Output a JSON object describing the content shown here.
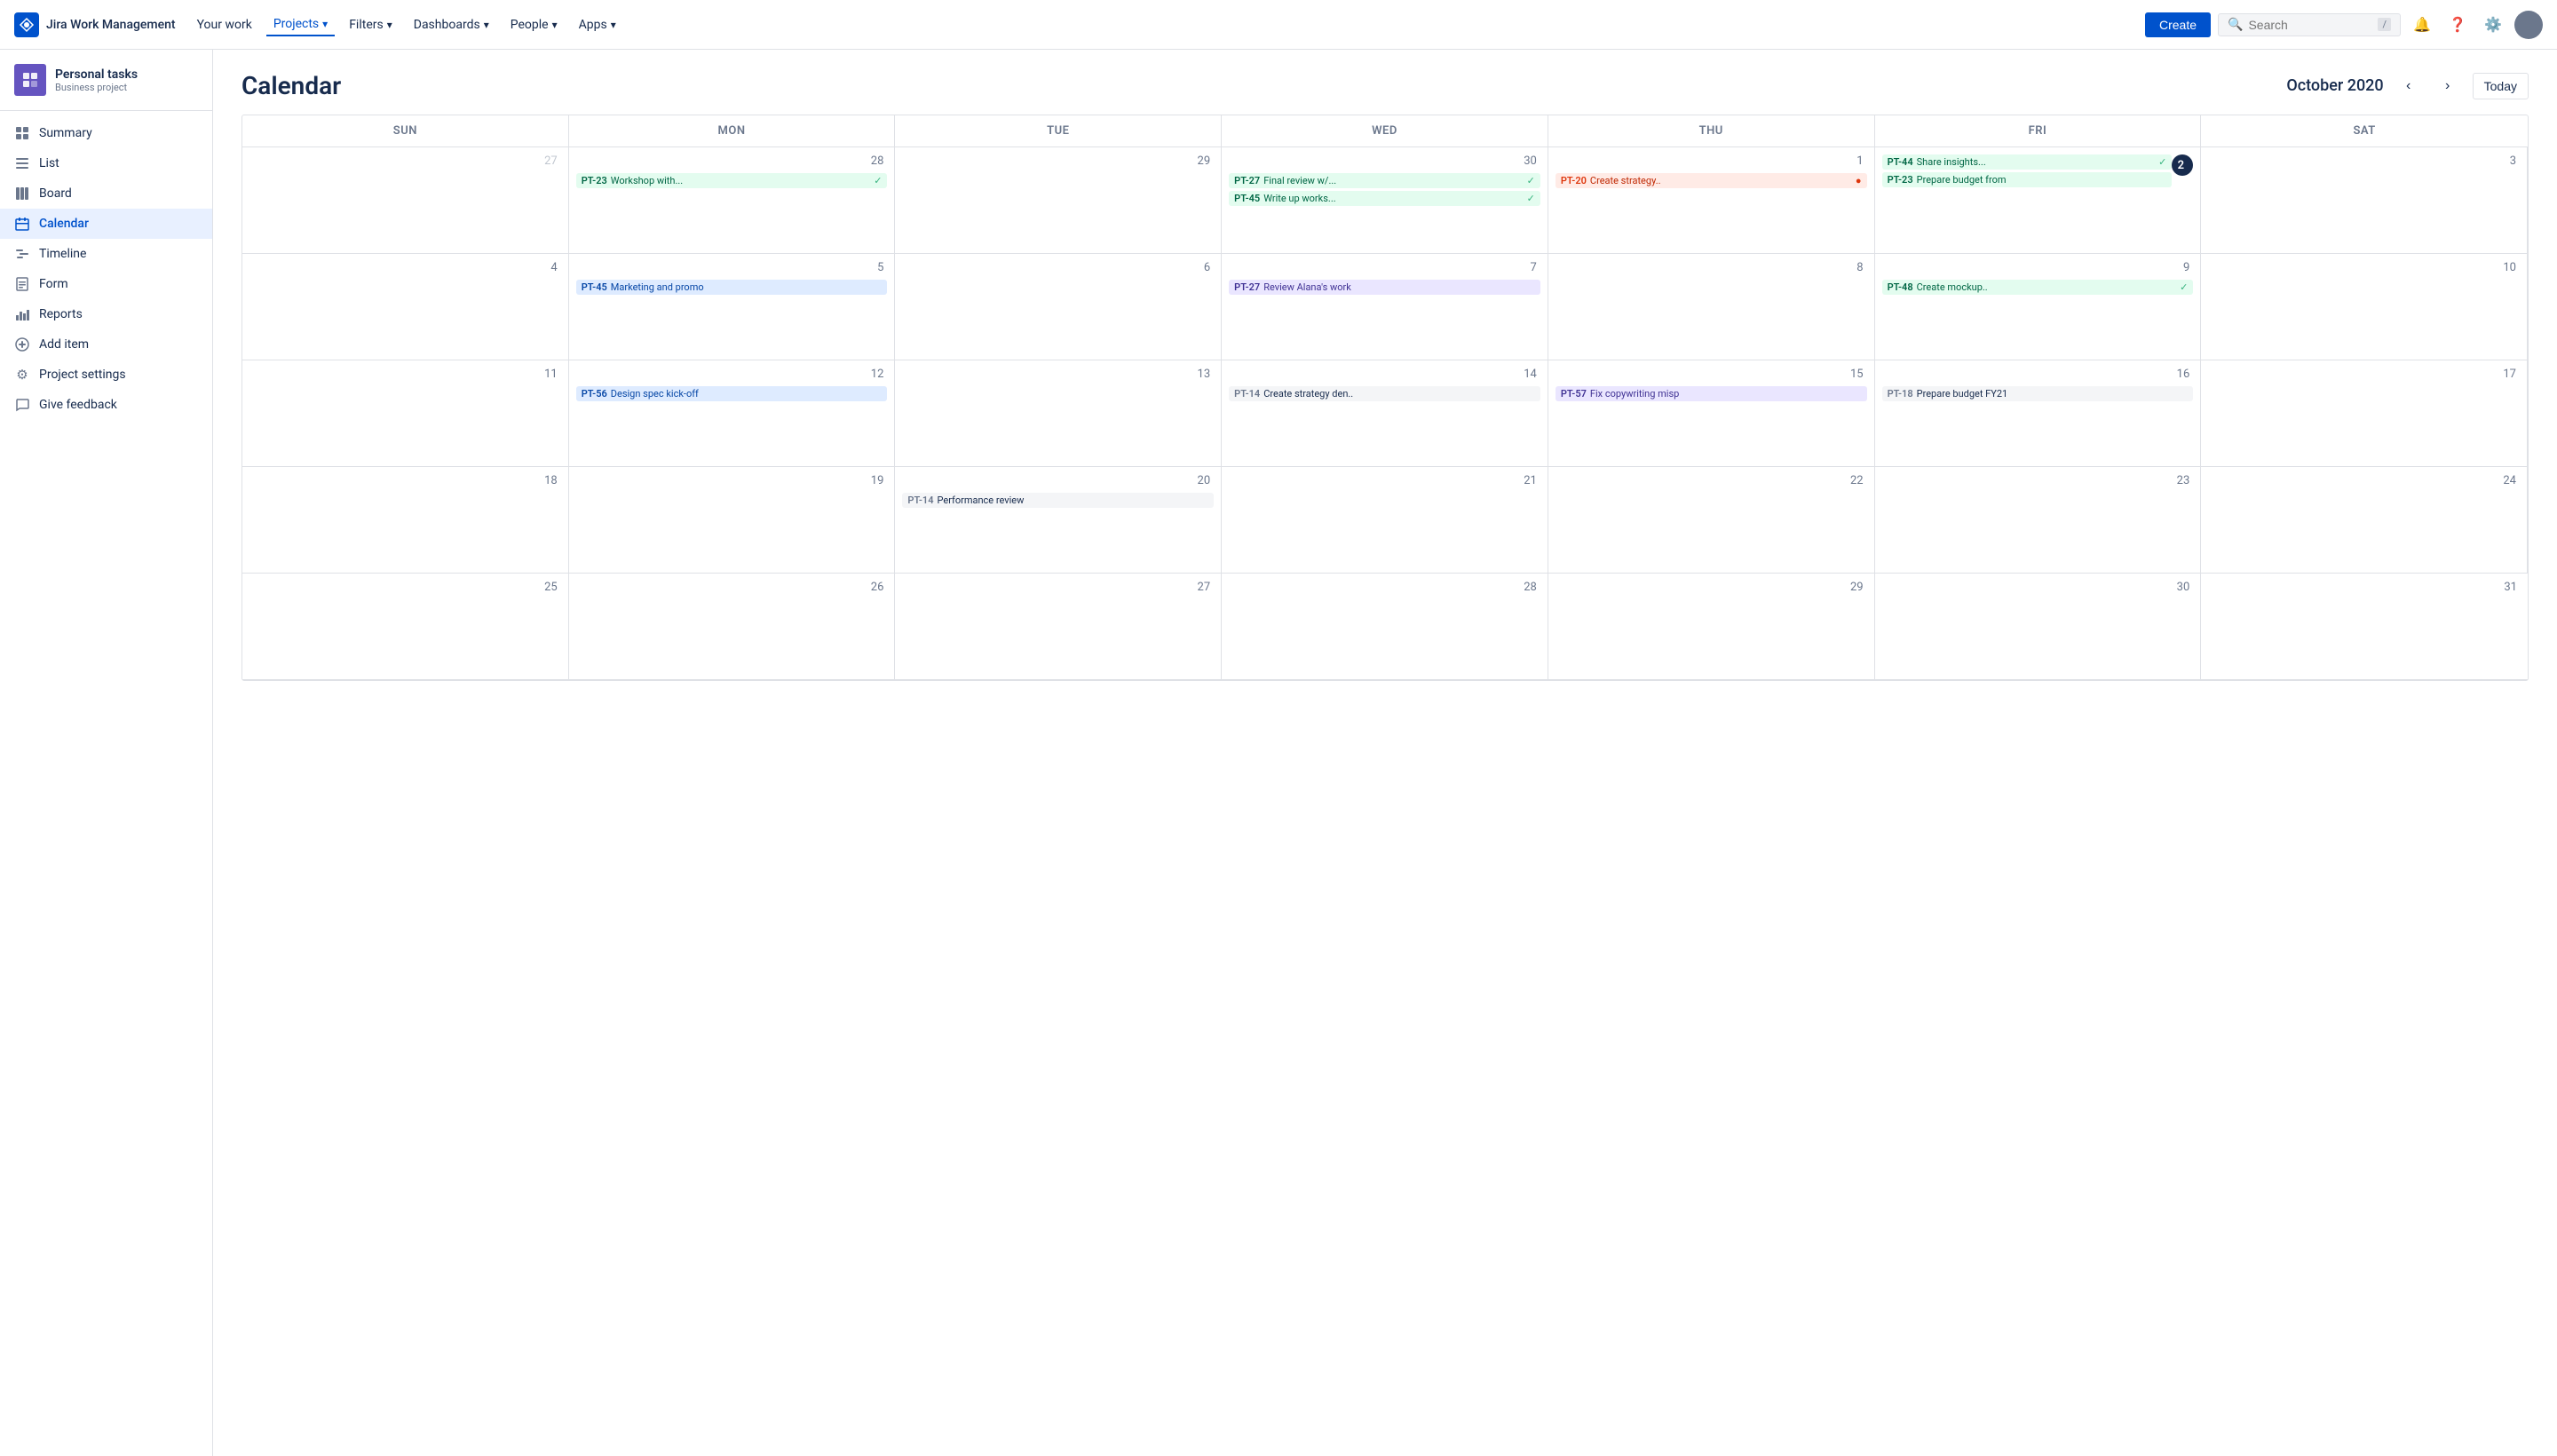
{
  "topnav": {
    "brand": "Jira Work Management",
    "items": [
      {
        "label": "Your work",
        "active": false
      },
      {
        "label": "Projects",
        "active": true
      },
      {
        "label": "Filters",
        "active": false
      },
      {
        "label": "Dashboards",
        "active": false
      },
      {
        "label": "People",
        "active": false
      },
      {
        "label": "Apps",
        "active": false
      }
    ],
    "create_label": "Create",
    "search_placeholder": "Search",
    "search_shortcut": "/"
  },
  "sidebar": {
    "project_name": "Personal tasks",
    "project_type": "Business project",
    "nav_items": [
      {
        "label": "Summary",
        "icon": "▦",
        "active": false
      },
      {
        "label": "List",
        "icon": "≡",
        "active": false
      },
      {
        "label": "Board",
        "icon": "⊞",
        "active": false
      },
      {
        "label": "Calendar",
        "icon": "▦",
        "active": true
      },
      {
        "label": "Timeline",
        "icon": "⊟",
        "active": false
      },
      {
        "label": "Form",
        "icon": "☐",
        "active": false
      },
      {
        "label": "Reports",
        "icon": "⌇",
        "active": false
      },
      {
        "label": "Add item",
        "icon": "⊕",
        "active": false
      },
      {
        "label": "Project settings",
        "icon": "⚙",
        "active": false
      },
      {
        "label": "Give feedback",
        "icon": "☍",
        "active": false
      }
    ]
  },
  "calendar": {
    "title": "Calendar",
    "month": "October 2020",
    "today_label": "Today",
    "day_headers": [
      "SUN",
      "MON",
      "TUE",
      "WED",
      "THU",
      "FRI",
      "SAT"
    ],
    "weeks": [
      {
        "days": [
          {
            "date": "27",
            "other_month": true,
            "tasks": []
          },
          {
            "date": "28",
            "other_month": false,
            "tasks": [
              {
                "id": "PT-23",
                "label": "Workshop with...",
                "color": "green",
                "check": true
              }
            ]
          },
          {
            "date": "29",
            "other_month": false,
            "tasks": []
          },
          {
            "date": "30",
            "other_month": false,
            "tasks": [
              {
                "id": "PT-27",
                "label": "Final review w/...",
                "color": "green",
                "check": true
              },
              {
                "id": "PT-45",
                "label": "Write up works...",
                "color": "green",
                "check": true
              }
            ]
          },
          {
            "date": "1",
            "other_month": false,
            "tasks": [
              {
                "id": "PT-20",
                "label": "Create strategy..",
                "color": "red",
                "error": true
              }
            ]
          },
          {
            "date": "2",
            "other_month": false,
            "today": true,
            "tasks": [
              {
                "id": "PT-44",
                "label": "Share insights...",
                "color": "green",
                "check": true
              },
              {
                "id": "PT-23",
                "label": "Prepare budget from",
                "color": "green",
                "check": false
              }
            ]
          },
          {
            "date": "3",
            "other_month": false,
            "tasks": []
          }
        ]
      },
      {
        "days": [
          {
            "date": "4",
            "other_month": false,
            "tasks": []
          },
          {
            "date": "5",
            "other_month": false,
            "tasks": [
              {
                "id": "PT-45",
                "label": "Marketing and promo",
                "color": "blue",
                "check": false
              }
            ]
          },
          {
            "date": "6",
            "other_month": false,
            "tasks": []
          },
          {
            "date": "7",
            "other_month": false,
            "tasks": [
              {
                "id": "PT-27",
                "label": "Review Alana's work",
                "color": "purple",
                "check": false
              }
            ]
          },
          {
            "date": "8",
            "other_month": false,
            "tasks": []
          },
          {
            "date": "9",
            "other_month": false,
            "tasks": [
              {
                "id": "PT-48",
                "label": "Create mockup..",
                "color": "green",
                "check": true
              }
            ]
          },
          {
            "date": "10",
            "other_month": false,
            "tasks": []
          }
        ]
      },
      {
        "days": [
          {
            "date": "11",
            "other_month": false,
            "tasks": []
          },
          {
            "date": "12",
            "other_month": false,
            "tasks": [
              {
                "id": "PT-56",
                "label": "Design spec kick-off",
                "color": "blue",
                "check": false
              }
            ]
          },
          {
            "date": "13",
            "other_month": false,
            "tasks": []
          },
          {
            "date": "14",
            "other_month": false,
            "tasks": [
              {
                "id": "PT-14",
                "label": "Create strategy den..",
                "color": "gray",
                "check": false
              }
            ]
          },
          {
            "date": "15",
            "other_month": false,
            "tasks": [
              {
                "id": "PT-57",
                "label": "Fix copywriting misp",
                "color": "purple",
                "check": false
              }
            ]
          },
          {
            "date": "16",
            "other_month": false,
            "tasks": [
              {
                "id": "PT-18",
                "label": "Prepare budget FY21",
                "color": "gray",
                "check": false
              }
            ]
          },
          {
            "date": "17",
            "other_month": false,
            "tasks": []
          }
        ]
      },
      {
        "days": [
          {
            "date": "18",
            "other_month": false,
            "tasks": []
          },
          {
            "date": "19",
            "other_month": false,
            "tasks": []
          },
          {
            "date": "20",
            "other_month": false,
            "tasks": [
              {
                "id": "PT-14",
                "label": "Performance review",
                "color": "gray",
                "check": false
              }
            ]
          },
          {
            "date": "21",
            "other_month": false,
            "tasks": []
          },
          {
            "date": "22",
            "other_month": false,
            "tasks": []
          },
          {
            "date": "23",
            "other_month": false,
            "tasks": []
          },
          {
            "date": "24",
            "other_month": false,
            "tasks": []
          }
        ]
      },
      {
        "days": [
          {
            "date": "25",
            "other_month": false,
            "tasks": []
          },
          {
            "date": "26",
            "other_month": false,
            "tasks": []
          },
          {
            "date": "27",
            "other_month": false,
            "tasks": []
          },
          {
            "date": "28",
            "other_month": false,
            "tasks": []
          },
          {
            "date": "29",
            "other_month": false,
            "tasks": []
          },
          {
            "date": "30",
            "other_month": false,
            "tasks": []
          },
          {
            "date": "31",
            "other_month": false,
            "tasks": []
          }
        ]
      }
    ]
  }
}
